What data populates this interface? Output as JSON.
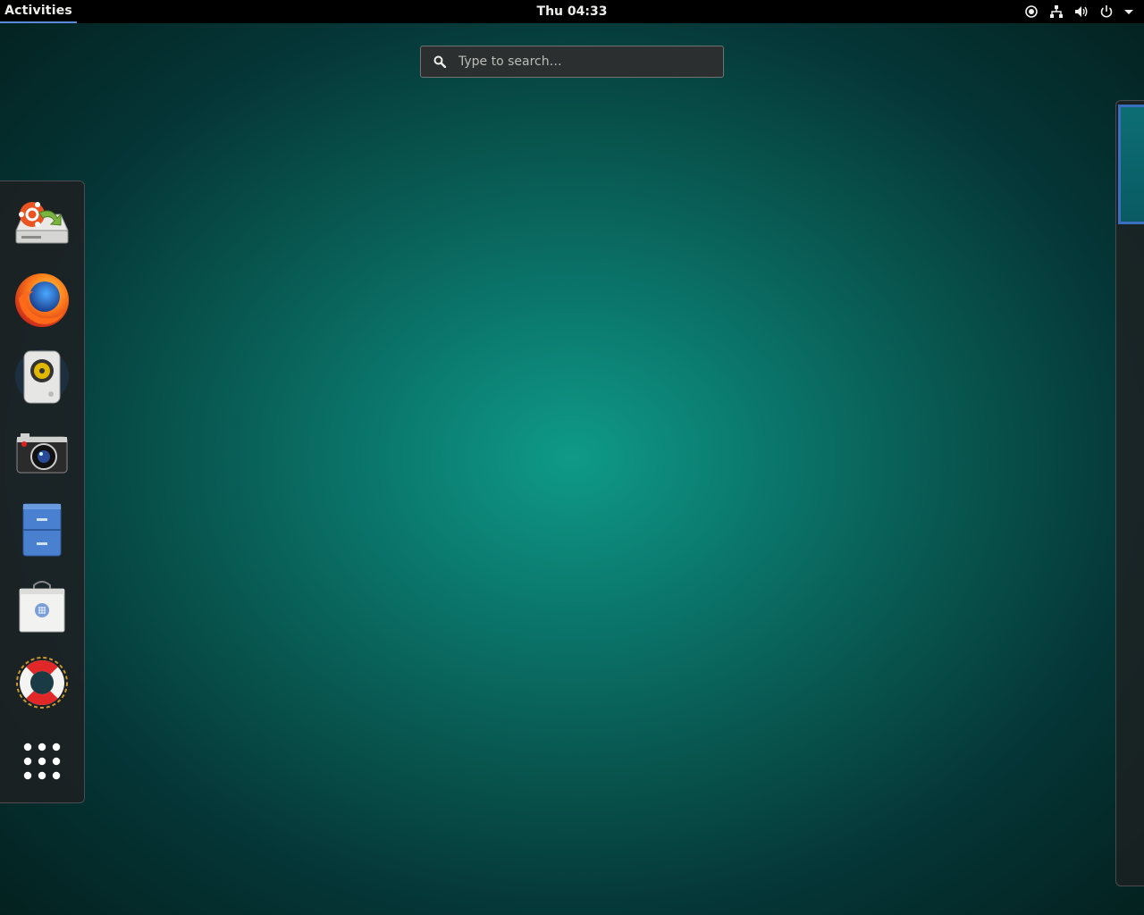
{
  "topbar": {
    "activities_label": "Activities",
    "clock": "Thu 04:33",
    "tray": [
      "location-icon",
      "network-icon",
      "volume-icon",
      "power-icon",
      "chevron-down-icon"
    ]
  },
  "search": {
    "placeholder": "Type to search…"
  },
  "dash": {
    "items": [
      {
        "name": "software-updater",
        "icon": "software-updater-icon"
      },
      {
        "name": "firefox",
        "icon": "firefox-icon"
      },
      {
        "name": "rhythmbox",
        "icon": "speaker-icon"
      },
      {
        "name": "cheese",
        "icon": "camera-icon"
      },
      {
        "name": "files",
        "icon": "file-cabinet-icon"
      },
      {
        "name": "software",
        "icon": "shopping-bag-icon"
      },
      {
        "name": "help",
        "icon": "lifebuoy-icon"
      },
      {
        "name": "show-applications",
        "icon": "app-grid-icon"
      }
    ]
  },
  "colors": {
    "topbar_bg": "#000000",
    "accent": "#5b8bd6",
    "wallpaper_center": "#0f9a87",
    "wallpaper_edge": "#03211f"
  }
}
